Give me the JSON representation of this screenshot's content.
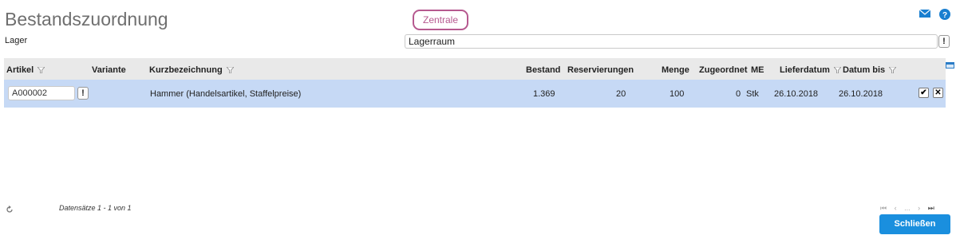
{
  "page": {
    "title": "Bestandszuordnung",
    "context_button": "Zentrale",
    "icons": {
      "mail": "envelope-icon",
      "help": "help-icon"
    }
  },
  "lager": {
    "label": "Lager",
    "value": "Lagerraum"
  },
  "table": {
    "columns": [
      "Artikel",
      "Variante",
      "Kurzbezeichnung",
      "Bestand",
      "Reservierungen",
      "Menge",
      "Zugeordnet",
      "ME",
      "Lieferdatum",
      "Datum bis"
    ],
    "rows": [
      {
        "artikel": "A000002",
        "variante": "",
        "kurzbezeichnung": "Hammer (Handelsartikel, Staffelpreise)",
        "bestand": "1.369",
        "reservierungen": "20",
        "menge": "100",
        "zugeordnet": "0",
        "me": "Stk",
        "lieferdatum": "26.10.2018",
        "datum_bis": "26.10.2018"
      }
    ]
  },
  "footer": {
    "records": "Datensätze 1 - 1 von 1",
    "pager": {
      "first": "⏮",
      "prev": "‹",
      "dots": "...",
      "next": "›",
      "last": "⏭"
    },
    "close_label": "Schließen"
  },
  "colors": {
    "accent": "#1a8fde",
    "context": "#b6598f",
    "row_selected": "#c6d9f5"
  }
}
